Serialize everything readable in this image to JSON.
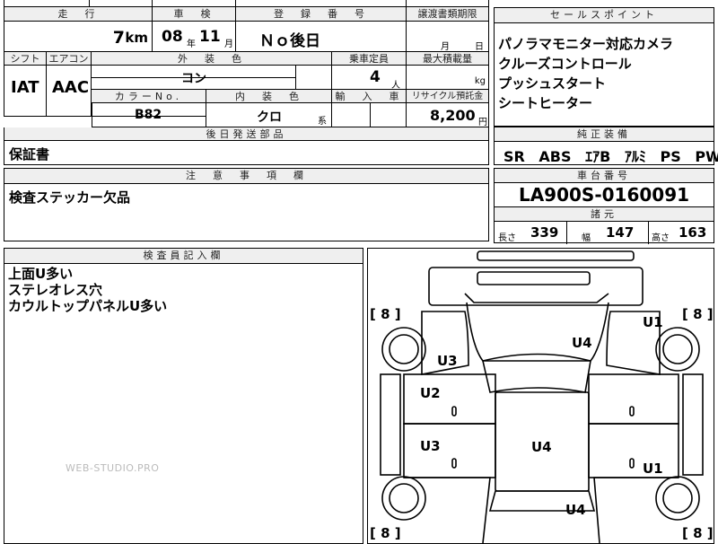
{
  "top": {
    "hdr_mileage": "走　行",
    "hdr_inspection": "車　検",
    "hdr_registration": "登　録　番　号",
    "hdr_transfer": "譲渡書類期限",
    "mileage_value": "7",
    "mileage_unit": "km",
    "insp_year": "08",
    "insp_year_unit": "年",
    "insp_month": "11",
    "insp_month_unit": "月",
    "registration_value": "Ｎｏ後日",
    "transfer_month": "月",
    "transfer_day": "日",
    "hdr_shift": "シフト",
    "hdr_aircon": "エアコン",
    "hdr_exterior": "外　装　色",
    "hdr_capacity": "乗車定員",
    "hdr_max_load": "最大積載量",
    "shift_value": "IAT",
    "aircon_value": "AAC",
    "exterior_value": "コン",
    "capacity_value": "4",
    "capacity_unit": "人",
    "max_load_unit": "kg",
    "hdr_color_no": "カラーNo.",
    "hdr_interior": "内　装　色",
    "hdr_import": "輸　入　車",
    "hdr_recycle": "リサイクル預託金",
    "color_no_value": "B82",
    "interior_value": "クロ",
    "interior_suffix": "系",
    "recycle_value": "8,200",
    "recycle_unit": "円",
    "hdr_later_parts": "後日発送部品",
    "later_parts_value": "保証書",
    "hdr_notes": "注　意　事　項　欄",
    "notes_value": "検査ステッカー欠品"
  },
  "sales": {
    "header": "セールスポイント",
    "lines": [
      "パノラマモニター対応カメラ",
      "クルーズコントロール",
      "プッシュスタート",
      "シートヒーター"
    ]
  },
  "equipment": {
    "header": "純正装備",
    "items": [
      "SR",
      "ABS",
      "ｴｱB",
      "ｱﾙﾐ",
      "PS",
      "PW"
    ]
  },
  "chassis": {
    "header": "車台番号",
    "value": "LA900S-0160091"
  },
  "specs": {
    "header": "諸元",
    "length_label": "長さ",
    "length_value": "339",
    "width_label": "幅",
    "width_value": "147",
    "height_label": "高さ",
    "height_value": "163"
  },
  "inspector": {
    "header": "検査員記入欄",
    "lines": [
      "上面U多い",
      "ステレオレス穴",
      "カウルトップパネルU多い"
    ]
  },
  "watermark": "WEB-STUDIO.PRO",
  "diagram": {
    "tire_marks": [
      "[ 8 ]",
      "[ 8 ]",
      "[ 8 ]",
      "[ 8 ]"
    ],
    "damage_codes": [
      "U4",
      "U1",
      "U3",
      "U2",
      "U3",
      "U4",
      "U1",
      "U4"
    ]
  }
}
